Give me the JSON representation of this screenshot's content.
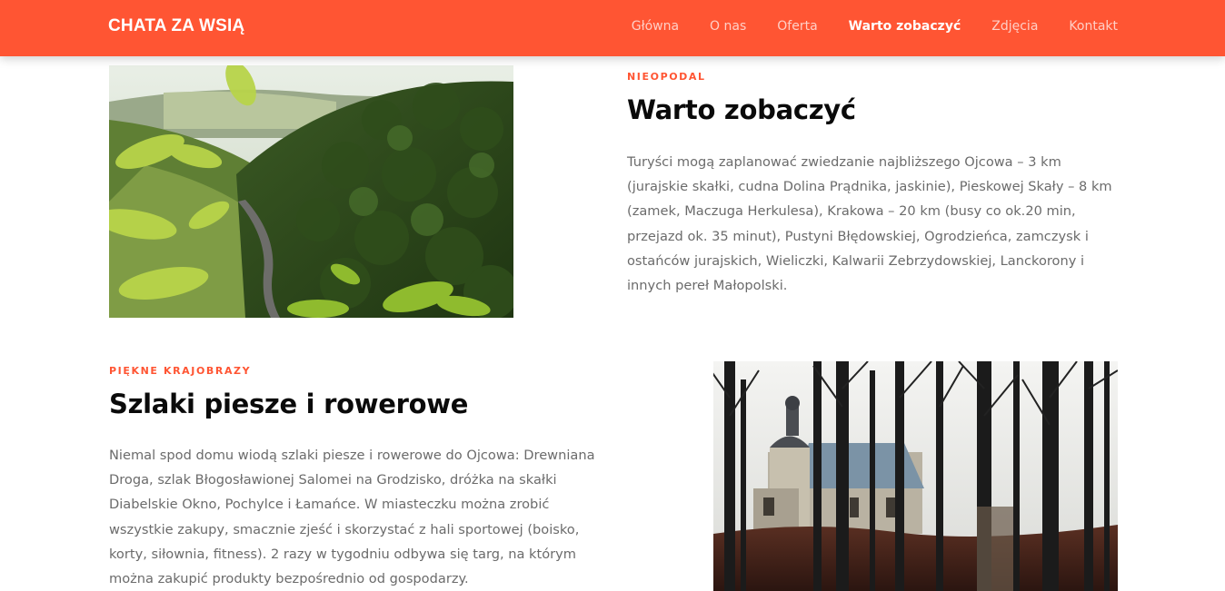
{
  "header": {
    "brand": "CHATA ZA WSIĄ",
    "nav": [
      {
        "label": "Główna",
        "active": false
      },
      {
        "label": "O nas",
        "active": false
      },
      {
        "label": "Oferta",
        "active": false
      },
      {
        "label": "Warto zobaczyć",
        "active": true
      },
      {
        "label": "Zdjęcia",
        "active": false
      },
      {
        "label": "Kontakt",
        "active": false
      }
    ]
  },
  "sections": [
    {
      "eyebrow": "NIEOPODAL",
      "title": "Warto zobaczyć",
      "text": "Turyści mogą zaplanować zwiedzanie najbliższego Ojcowa – 3 km (jurajskie skałki, cudna Dolina Prądnika, jaskinie), Pieskowej Skały – 8 km (zamek, Maczuga Herkulesa), Krakowa – 20 km (busy co ok.20 min, przejazd ok. 35 minut), Pustyni Błędowskiej, Ogrodzieńca, zamczysk i ostańców jurajskich, Wieliczki, Kalwarii Zebrzydowskiej, Lanckorony i innych pereł Małopolski.",
      "image": "valley-forest-road-photo"
    },
    {
      "eyebrow": "PIĘKNE KRAJOBRAZY",
      "title": "Szlaki piesze i rowerowe",
      "text": "Niemal spod domu wiodą szlaki piesze i rowerowe do Ojcowa: Drewniana Droga, szlak Błogosławionej Salomei na Grodzisko, dróżka na skałki Diabelskie Okno, Pochylce i Łamańce. W miasteczku można zrobić wszystkie zakupy, smacznie zjeść i skorzystać z hali sportowej (boisko, korty, siłownia, fitness). 2 razy w tygodniu odbywa się targ, na którym można zakupić produkty bezpośrednio od gospodarzy.",
      "image": "chapel-winter-trees-photo"
    }
  ],
  "colors": {
    "accent": "#ff5533",
    "heading": "#0a0a0a",
    "body": "#6b6b6b"
  }
}
